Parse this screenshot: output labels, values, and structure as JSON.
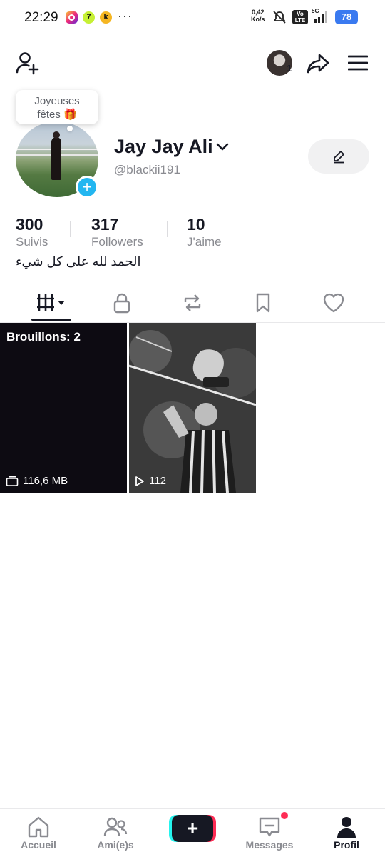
{
  "status_bar": {
    "time": "22:29",
    "more": "···",
    "net_speed_value": "0,42",
    "net_speed_unit": "Ko/s",
    "volte": "Vo LTE",
    "network": "5G",
    "battery": "78",
    "notif_icons": [
      "instagram-icon",
      "app-7-icon",
      "app-k-icon"
    ]
  },
  "top_bar": {
    "account_count": "1"
  },
  "profile": {
    "bubble_text_line1": "Joyeuses",
    "bubble_text_line2": "fêtes 🎁",
    "display_name": "Jay Jay Ali",
    "username": "@blackii191",
    "bio": "الحمد لله على كل شيء"
  },
  "stats": [
    {
      "value": "300",
      "label": "Suivis"
    },
    {
      "value": "317",
      "label": "Followers"
    },
    {
      "value": "10",
      "label": "J'aime"
    }
  ],
  "tabs": [
    "videos-grid-icon",
    "lock-icon",
    "repost-icon",
    "bookmark-icon",
    "heart-icon"
  ],
  "grid": {
    "drafts_label": "Brouillons: 2",
    "drafts_size": "116,6 MB",
    "video_views": "112"
  },
  "bottom_nav": {
    "home": "Accueil",
    "friends": "Ami(e)s",
    "create": "+",
    "messages": "Messages",
    "profile": "Profil"
  },
  "colors": {
    "accent_blue": "#23b6f0",
    "brand_cyan": "#25f4ee",
    "brand_red": "#fe2c55",
    "text_primary": "#161823",
    "text_secondary": "#8a8b91"
  }
}
